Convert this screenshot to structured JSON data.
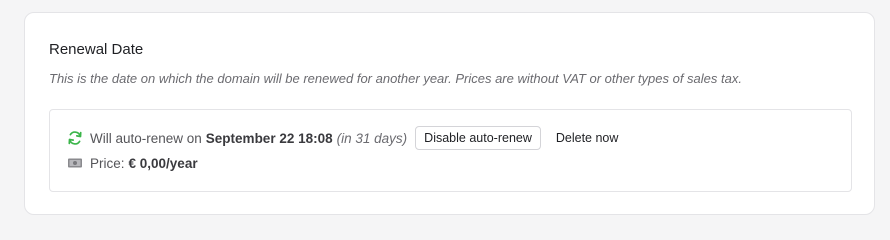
{
  "section": {
    "title": "Renewal Date",
    "description": "This is the date on which the domain will be renewed for another year. Prices are without VAT or other types of sales tax."
  },
  "renewal": {
    "icon": "refresh-icon",
    "prefix": "Will auto-renew on",
    "date": "September 22 18:08",
    "relative": "(in 31 days)",
    "disable_button": "Disable auto-renew",
    "delete_button": "Delete now"
  },
  "price": {
    "icon": "banknote-icon",
    "label": "Price:",
    "value": "€ 0,00/year"
  },
  "colors": {
    "refresh_icon": "#3bb54a",
    "card_border": "#e4e4e7",
    "background": "#f5f5f6"
  }
}
